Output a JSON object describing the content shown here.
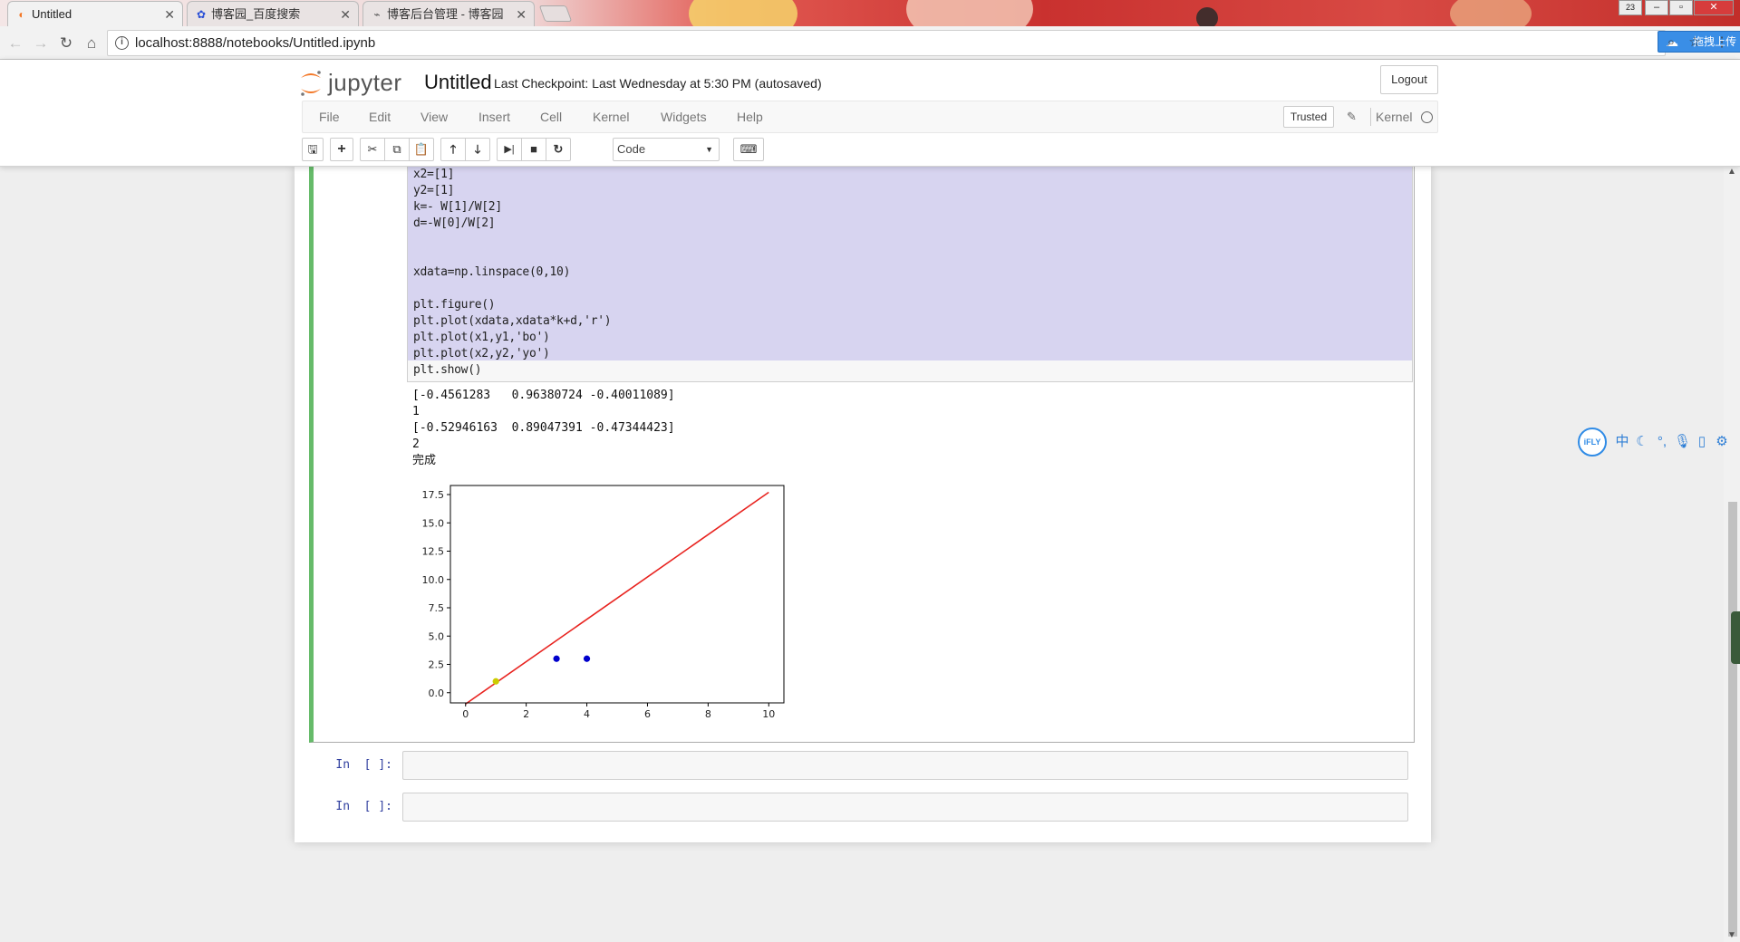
{
  "browser": {
    "tabs": [
      {
        "title": "Untitled",
        "icon": "jupyter-icon",
        "active": true
      },
      {
        "title": "博客园_百度搜索",
        "icon": "baidu-paw-icon",
        "active": false
      },
      {
        "title": "博客后台管理 - 博客园",
        "icon": "cnblogs-icon",
        "active": false
      }
    ],
    "url": "localhost:8888/notebooks/Untitled.ipynb",
    "upload_label": "拖拽上传"
  },
  "jupyter": {
    "logo_text": "jupyter",
    "notebook_name": "Untitled",
    "checkpoint": "Last Checkpoint: Last Wednesday at 5:30 PM (autosaved)",
    "logout": "Logout",
    "menus": [
      "File",
      "Edit",
      "View",
      "Insert",
      "Cell",
      "Kernel",
      "Widgets",
      "Help"
    ],
    "trusted": "Trusted",
    "kernel_label": "Kernel",
    "cell_type": "Code"
  },
  "cell1": {
    "code_lines": [
      "x2=[1]",
      "y2=[1]",
      "k=- W[1]/W[2]",
      "d=-W[0]/W[2]",
      "",
      "",
      "xdata=np.linspace(0,10)",
      "",
      "plt.figure()",
      "plt.plot(xdata,xdata*k+d,'r')",
      "plt.plot(x1,y1,'bo')",
      "plt.plot(x2,y2,'yo')",
      "plt.show()"
    ],
    "output_lines": [
      "[-0.4561283   0.96380724 -0.40011089]",
      "1",
      "[-0.52946163  0.89047391 -0.47344423]",
      "2",
      "完成"
    ]
  },
  "empty_cells": [
    {
      "prompt": "In  [ ]:"
    },
    {
      "prompt": "In  [ ]:"
    }
  ],
  "chart_data": {
    "type": "line",
    "xlim": [
      -0.5,
      10.5
    ],
    "ylim": [
      -0.9,
      18.3
    ],
    "xticks": [
      0,
      2,
      4,
      6,
      8,
      10
    ],
    "yticks": [
      0.0,
      2.5,
      5.0,
      7.5,
      10.0,
      12.5,
      15.0,
      17.5
    ],
    "xtick_labels": [
      "0",
      "2",
      "4",
      "6",
      "8",
      "10"
    ],
    "ytick_labels": [
      "0.0",
      "2.5",
      "5.0",
      "7.5",
      "10.0",
      "12.5",
      "15.0",
      "17.5"
    ],
    "series": [
      {
        "kind": "line",
        "color": "#e8231f",
        "x": [
          0,
          10
        ],
        "y": [
          -1.0,
          17.7
        ]
      },
      {
        "kind": "points",
        "color": "#0000cc",
        "x": [
          3,
          4
        ],
        "y": [
          3,
          3
        ]
      },
      {
        "kind": "points",
        "color": "#cccc00",
        "x": [
          1
        ],
        "y": [
          1
        ]
      }
    ],
    "grid": false
  },
  "ifly": {
    "logo": "iFLY",
    "icons": [
      "zh-icon",
      "moon-icon",
      "punct-icon",
      "mic-icon",
      "keyboard-icon",
      "gear-icon"
    ],
    "zh_label": "中"
  },
  "colors": {
    "selected_cell_border": "#66bb6a",
    "code_selection": "#d7d4f0",
    "prompt": "#303f9f"
  }
}
